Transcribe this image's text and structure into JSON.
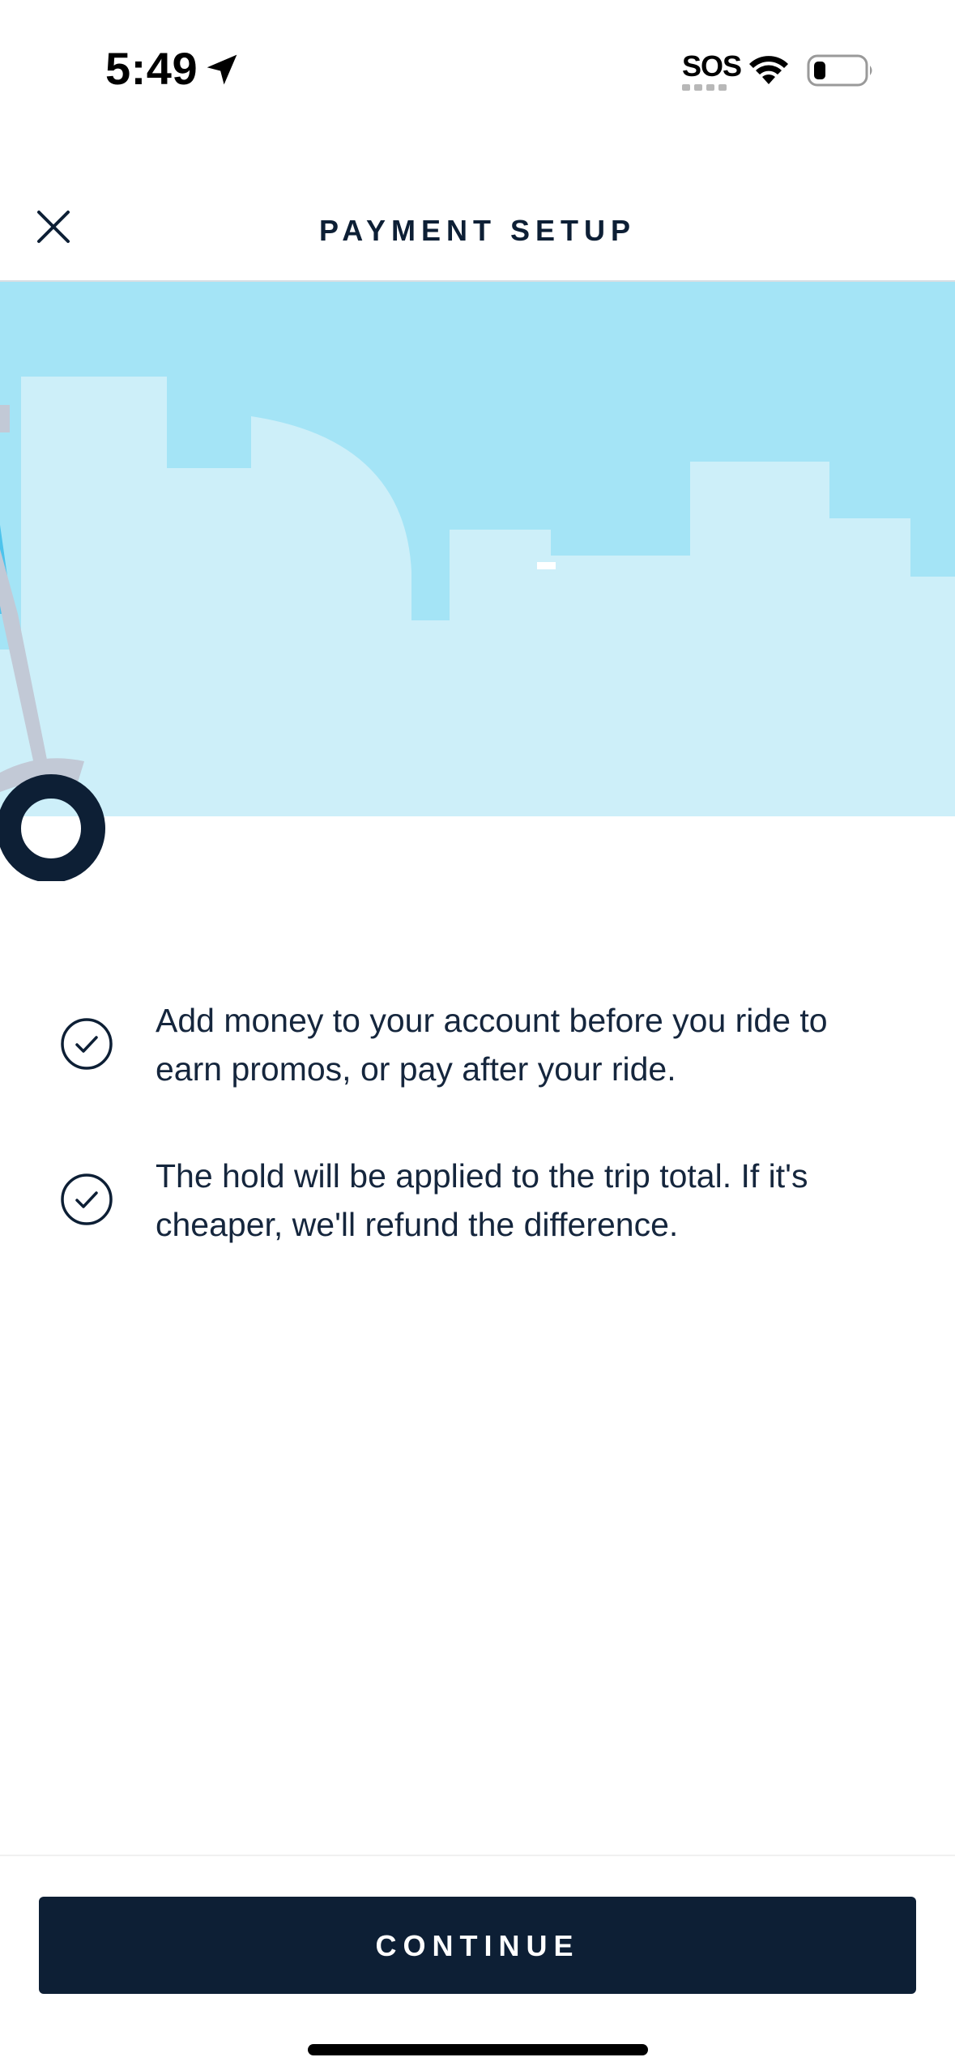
{
  "status_bar": {
    "time": "5:49",
    "sos": "SOS",
    "icons": [
      "location-arrow-icon",
      "wifi-icon",
      "battery-icon"
    ]
  },
  "header": {
    "title": "PAYMENT SETUP",
    "close_icon": "close-icon"
  },
  "illustration": {
    "sky_color": "#a4e4f6",
    "building_color": "#cdeff9",
    "scooter_colors": [
      "#c2c9d6",
      "#0d1f35",
      "#4dc3ec"
    ]
  },
  "checklist": {
    "items": [
      {
        "icon": "check-circle-icon",
        "text": "Add money to your account before you ride to earn promos, or pay after your ride."
      },
      {
        "icon": "check-circle-icon",
        "text": "The hold will be applied to the trip total. If it's cheaper, we'll refund the difference."
      }
    ]
  },
  "footer": {
    "continue_label": "CONTINUE",
    "button_color": "#0d1f35"
  }
}
